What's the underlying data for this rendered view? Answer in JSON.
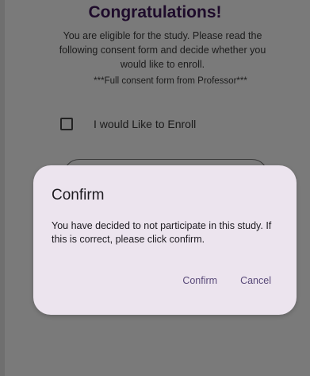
{
  "page": {
    "title": "Congratulations!",
    "intro": "You are eligible for the study. Please read the following consent form and decide whether you would like to enroll.",
    "consent_note": "***Full consent form from Professor***",
    "enroll_label": "I would Like to Enroll",
    "enroll_checked": false
  },
  "dialog": {
    "title": "Confirm",
    "body": "You have decided to not participate in this study. If this is correct, please click confirm.",
    "confirm_label": "Confirm",
    "cancel_label": "Cancel"
  },
  "colors": {
    "scrim": "#7a7a7a",
    "dialog_bg": "#ece4ee",
    "title": "#1e0b2b",
    "action": "#5a4b7a"
  }
}
